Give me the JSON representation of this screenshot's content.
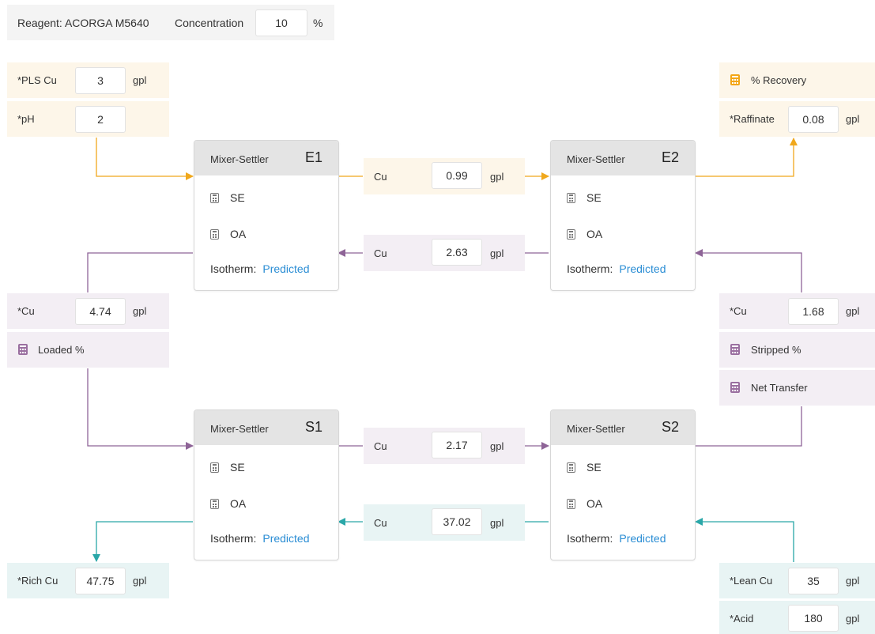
{
  "reagent": {
    "label": "Reagent: ACORGA M5640",
    "concentration_label": "Concentration",
    "concentration_value": "10",
    "concentration_unit": "%"
  },
  "feed": {
    "pls_cu_label": "*PLS Cu",
    "pls_cu_value": "3",
    "pls_cu_unit": "gpl",
    "ph_label": "*pH",
    "ph_value": "2"
  },
  "recovery": {
    "recovery_label": "% Recovery",
    "raffinate_label": "*Raffinate",
    "raffinate_value": "0.08",
    "raffinate_unit": "gpl"
  },
  "loaded": {
    "cu_label": "*Cu",
    "cu_value": "4.74",
    "cu_unit": "gpl",
    "loaded_label": "Loaded %"
  },
  "stripped": {
    "cu_label": "*Cu",
    "cu_value": "1.68",
    "cu_unit": "gpl",
    "stripped_label": "Stripped %",
    "net_transfer_label": "Net Transfer"
  },
  "rich": {
    "label": "*Rich Cu",
    "value": "47.75",
    "unit": "gpl"
  },
  "lean": {
    "label": "*Lean Cu",
    "value": "35",
    "unit": "gpl",
    "acid_label": "*Acid",
    "acid_value": "180",
    "acid_unit": "gpl"
  },
  "streams": {
    "e_aq": {
      "label": "Cu",
      "value": "0.99",
      "unit": "gpl"
    },
    "e_org": {
      "label": "Cu",
      "value": "2.63",
      "unit": "gpl"
    },
    "s_org": {
      "label": "Cu",
      "value": "2.17",
      "unit": "gpl"
    },
    "s_aq": {
      "label": "Cu",
      "value": "37.02",
      "unit": "gpl"
    }
  },
  "cards": [
    {
      "title": "Mixer-Settler",
      "id": "E1",
      "se": "SE",
      "oa": "OA",
      "isotherm_label": "Isotherm:",
      "isotherm_value": "Predicted"
    },
    {
      "title": "Mixer-Settler",
      "id": "E2",
      "se": "SE",
      "oa": "OA",
      "isotherm_label": "Isotherm:",
      "isotherm_value": "Predicted"
    },
    {
      "title": "Mixer-Settler",
      "id": "S1",
      "se": "SE",
      "oa": "OA",
      "isotherm_label": "Isotherm:",
      "isotherm_value": "Predicted"
    },
    {
      "title": "Mixer-Settler",
      "id": "S2",
      "se": "SE",
      "oa": "OA",
      "isotherm_label": "Isotherm:",
      "isotherm_value": "Predicted"
    }
  ],
  "colors": {
    "orange": "#f0a81c",
    "purple": "#8e6497",
    "teal": "#2aa7a8",
    "link": "#2a8dd4"
  }
}
